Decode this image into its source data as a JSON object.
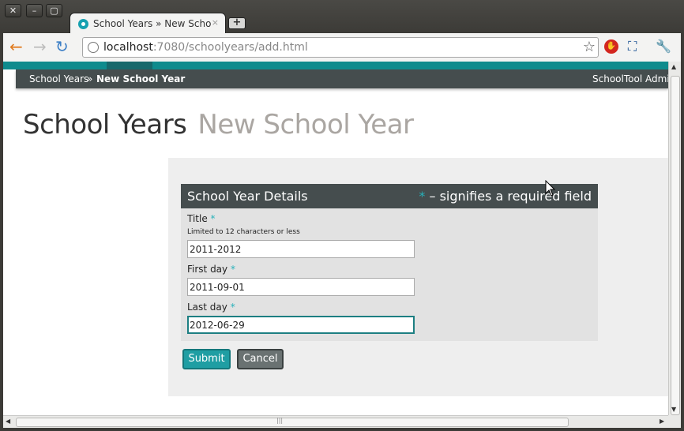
{
  "window": {
    "close_glyph": "✕",
    "minimize_glyph": "–",
    "maximize_glyph": "▢"
  },
  "tab": {
    "title": "School Years » New School Year",
    "close_glyph": "×",
    "new_tab_glyph": "+"
  },
  "toolbar": {
    "back_icon": "←",
    "forward_icon": "→",
    "reload_icon": "↻",
    "url_host": "localhost",
    "url_rest": ":7080/schoolyears/add.html",
    "star_icon": "☆",
    "stop_icon": "✋",
    "fullscreen_icon": "⛶",
    "wrench_icon": "🔧"
  },
  "breadcrumb": {
    "item1": "School Years",
    "separator": "»",
    "item2": "New School Year",
    "user": "SchoolTool Administrator"
  },
  "page": {
    "title": "School Years",
    "subtitle": "New School Year"
  },
  "form": {
    "heading": "School Year Details",
    "required_star": "*",
    "required_note": "– signifies a required field",
    "title_label": "Title",
    "title_hint": "Limited to 12 characters or less",
    "title_value": "2011-2012",
    "first_day_label": "First day",
    "first_day_value": "2011-09-01",
    "last_day_label": "Last day",
    "last_day_value": "2012-06-29",
    "submit_label": "Submit",
    "cancel_label": "Cancel"
  },
  "scrollbar": {
    "up_arrow": "▲",
    "down_arrow": "▼",
    "left_arrow": "◀",
    "right_arrow": "▶",
    "grip": "|||"
  },
  "colors": {
    "accent": "#0f8b8d",
    "header_dark": "#454d4e",
    "required": "#27b1b9",
    "submit": "#1f9ea3",
    "cancel": "#6a7272"
  }
}
